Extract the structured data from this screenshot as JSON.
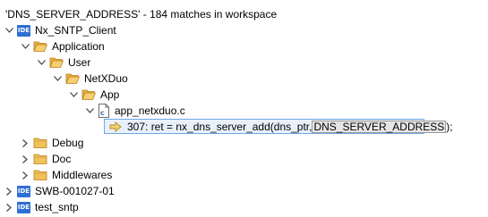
{
  "summary": "'DNS_SERVER_ADDRESS' - 184 matches in workspace",
  "tree": {
    "project1": "Nx_SNTP_Client",
    "application": "Application",
    "user": "User",
    "netxduo": "NetXDuo",
    "app": "App",
    "file": "app_netxduo.c",
    "match_prefix": "307: ret = nx_dns_server_add(dns_ptr, ",
    "match_highlight": "DNS_SERVER_ADDRESS",
    "match_suffix": ");",
    "debug": "Debug",
    "doc": "Doc",
    "middlewares": "Middlewares",
    "project2": "SWB-001027-01",
    "project3": "test_sntp"
  },
  "icons": {
    "project": "IDE",
    "expanded": "chevron-down-icon",
    "collapsed": "chevron-right-icon",
    "folder": "folder-icon",
    "c_file": "c-file-icon",
    "match": "match-arrow-icon"
  },
  "colors": {
    "ide_badge": "#2f6fd1",
    "folder": "#e8b04a",
    "selection_bg": "#e8f1fb",
    "selection_border": "#6fa8e6"
  }
}
